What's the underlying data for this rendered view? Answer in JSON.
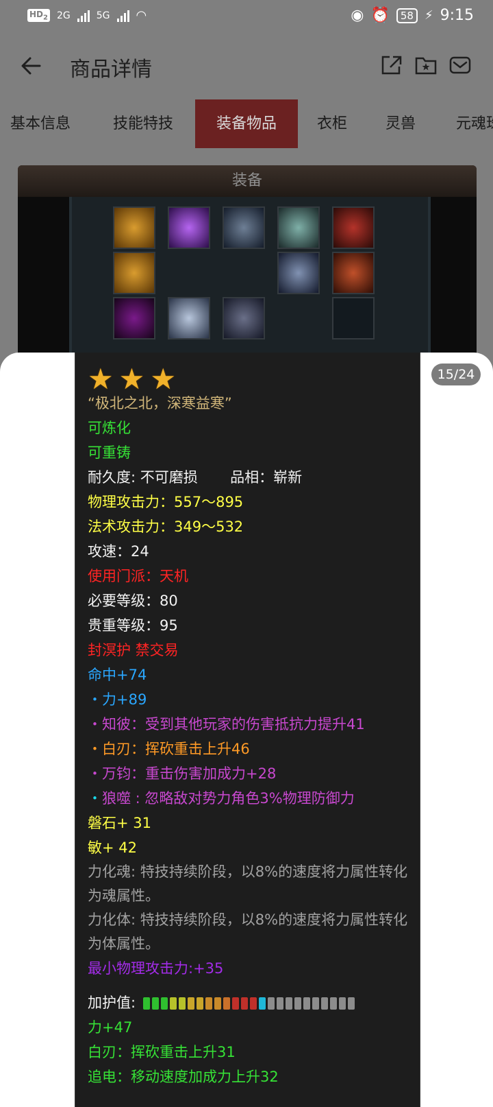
{
  "status_bar": {
    "hd_label": "HD",
    "hd_sub": "2",
    "net1": "2G",
    "net2": "5G",
    "battery": "58",
    "time": "9:15"
  },
  "header": {
    "title": "商品详情",
    "icons": [
      "back-arrow-icon",
      "share-icon",
      "favorite-folder-icon",
      "mail-icon"
    ]
  },
  "tabs": [
    {
      "label": "基本信息",
      "active": false
    },
    {
      "label": "技能特技",
      "active": false
    },
    {
      "label": "装备物品",
      "active": true
    },
    {
      "label": "衣柜",
      "active": false
    },
    {
      "label": "灵兽",
      "active": false
    },
    {
      "label": "元魂珠",
      "active": false
    }
  ],
  "equipment": {
    "title": "装备"
  },
  "viewer": {
    "counter": "15/24"
  },
  "item": {
    "quote": "“极北之北，深寒益寒”",
    "smeltable": "可炼化",
    "recastable": "可重铸",
    "durability": "耐久度: 不可磨损",
    "condition": "品相：崭新",
    "phys_attack": "物理攻击力：557～895",
    "magic_attack": "法术攻击力：349～532",
    "attack_speed": "攻速：24",
    "sect": "使用门派：天机",
    "req_level": "必要等级：80",
    "value_level": "贵重等级：95",
    "binding": "封溟护 禁交易",
    "hit": "命中+74",
    "strength_line": "・力+89",
    "zhibi": "・知彼：受到其他玩家的伤害抵抗力提升41",
    "bairen": "・白刃：挥砍重击上升46",
    "wanjun": "・万钧：重击伤害加成力+28",
    "langshi": "・狼噬 : 忽略敌对势力角色3%物理防御力",
    "panshi": "磐石+ 31",
    "agility": "敏+ 42",
    "hua_soul": "力化魂: 特技持续阶段，以8%的速度将力属性转化为魂属性。",
    "hua_body": "力化体: 特技持续阶段，以8%的速度将力属性转化为体属性。",
    "min_phys": "最小物理攻击力:+35",
    "protect_label": "加护值:",
    "protect_level": 0.58,
    "bonus_strength": "力+47",
    "bonus_bairen": "白刃：挥砍重击上升31",
    "bonus_zhuidian": "追电：移动速度加成力上升32"
  },
  "colors": {
    "tab_active_bg": "#6b2121",
    "green": "#36e236",
    "yellow": "#ffff46",
    "red": "#ff2424",
    "blue": "#2aa7ff",
    "pink": "#c848cf",
    "orange": "#ff9a26",
    "cyan": "#1ad8e8",
    "purple": "#a32ce8",
    "gray": "#a2a2a2"
  }
}
